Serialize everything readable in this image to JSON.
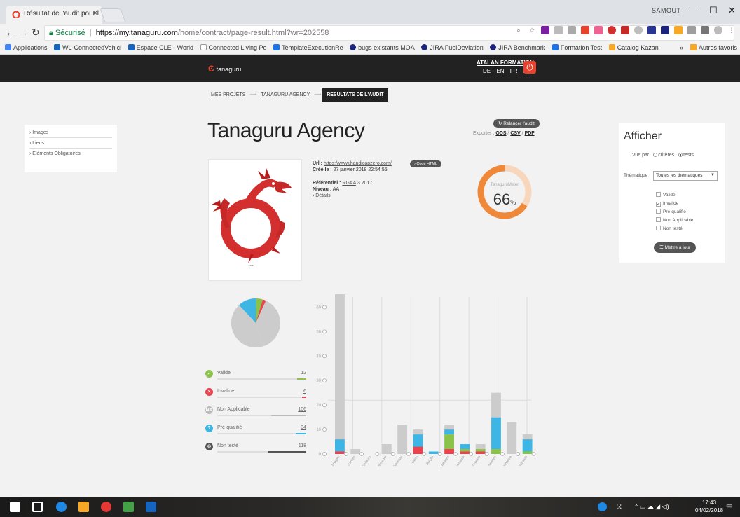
{
  "browser": {
    "tab_title": "Résultat de l'audit pour l",
    "tab_close": "×",
    "user_label": "SAMOUT",
    "minimize": "—",
    "maximize": "☐",
    "close": "✕",
    "secure_label": "Sécurisé",
    "url_host": "https://my.tanaguru.com",
    "url_path": "/home/contract/page-result.html?wr=202558"
  },
  "bookmarks": [
    {
      "label": "Applications",
      "color": "#4285f4"
    },
    {
      "label": "WL-ConnectedVehicl",
      "color": "#1565c0"
    },
    {
      "label": "Espace CLE - World",
      "color": "#1565c0"
    },
    {
      "label": "Connected Living Po",
      "color": "#9e9e9e"
    },
    {
      "label": "TemplateExecutionRe",
      "color": "#1a73e8"
    },
    {
      "label": "bugs existants MOA",
      "color": "#1a237e"
    },
    {
      "label": "JIRA FuelDeviation",
      "color": "#1a237e"
    },
    {
      "label": "JIRA Benchmark",
      "color": "#1a237e"
    },
    {
      "label": "Formation Test",
      "color": "#1a73e8"
    },
    {
      "label": "Catalog Kazan",
      "color": "#f9a825"
    }
  ],
  "bookmarks_more": "»",
  "bookmarks_other": "Autres favoris",
  "header": {
    "logo_text": "tanaguru",
    "account": "ATALAN FORMATION",
    "langs": [
      "DE",
      "EN",
      "FR",
      "ES"
    ]
  },
  "breadcrumb": {
    "items": [
      "MES PROJETS",
      "TANAGURU AGENCY"
    ],
    "separator": "⟶",
    "active": "RESULTATS DE L'AUDIT"
  },
  "sidebar": {
    "items": [
      "Images",
      "Liens",
      "Eléments Obligatoires"
    ]
  },
  "audit": {
    "title": "Tanaguru Agency",
    "relaunch_label": "Relancer l'audit",
    "export_label": "Exporter :",
    "export_formats": [
      "ODS",
      "CSV",
      "PDF"
    ],
    "url_label": "Url :",
    "url_value": "https://www.handicapzero.com/",
    "code_button": "Code HTML",
    "created_label": "Créé le :",
    "created_value": "27 janvier 2018 22:54:55",
    "ref_label": "Référentiel :",
    "ref_abbr": "RGAA",
    "ref_version": "3 2017",
    "level_label": "Niveau :",
    "level_value": "AA",
    "details_label": "Détails"
  },
  "gauge": {
    "label": "TanaguruMeter",
    "value": "66",
    "unit": "%",
    "fraction": 0.66,
    "color": "#f0883a",
    "track_color": "#f8d6bb"
  },
  "panel": {
    "title": "Afficher",
    "vue_label": "Vue par",
    "vue_options": [
      "critères",
      "tests"
    ],
    "vue_selected": "tests",
    "theme_label": "Thématique",
    "theme_value": "Toutes les thématiques",
    "checkboxes": [
      {
        "label": "Valide",
        "checked": false
      },
      {
        "label": "Invalide",
        "checked": true
      },
      {
        "label": "Pré-qualifié",
        "checked": false
      },
      {
        "label": "Non Applicable",
        "checked": false
      },
      {
        "label": "Non testé",
        "checked": false
      }
    ],
    "update_label": "Mettre à jour"
  },
  "legend": [
    {
      "label": "Valide",
      "count": "12",
      "color": "#8bc34a",
      "icon": "✓",
      "fill": 0.1
    },
    {
      "label": "Invalide",
      "count": "6",
      "color": "#e8434f",
      "icon": "✕",
      "fill": 0.05
    },
    {
      "label": "Non Applicable",
      "count": "106",
      "color": "#bbbbbb",
      "icon": "NA",
      "fill": 0.39
    },
    {
      "label": "Pré-qualifié",
      "count": "34",
      "color": "#3db6e6",
      "icon": "?",
      "fill": 0.12
    },
    {
      "label": "Non testé",
      "count": "118",
      "color": "#555555",
      "icon": "⊘",
      "fill": 0.43
    }
  ],
  "chart_data": [
    {
      "type": "pie",
      "labels": [
        "Valide",
        "Invalide",
        "Non Applicable",
        "Pré-qualifié",
        "Non testé"
      ],
      "values": [
        12,
        6,
        106,
        34,
        118
      ],
      "colors": [
        "#8bc34a",
        "#e8434f",
        "#cccccc",
        "#3db6e6",
        "#cccccc"
      ]
    },
    {
      "type": "bar",
      "stacked": true,
      "categories": [
        "Images",
        "Cadres",
        "Couleurs",
        "Multimédia",
        "Tableaux",
        "Liens",
        "Scripts",
        "Eléments Obligatoires",
        "Structuration de l'information",
        "Présentation de l'information",
        "Formulaires",
        "Navigation",
        "Consultation"
      ],
      "series": [
        {
          "name": "Invalide",
          "color": "#e8434f",
          "values": [
            1,
            0,
            0,
            0,
            0,
            3,
            0,
            2,
            1,
            1,
            0,
            0,
            0
          ]
        },
        {
          "name": "Valide",
          "color": "#8bc34a",
          "values": [
            0,
            0,
            0,
            0,
            0,
            0,
            0,
            6,
            1,
            1,
            2,
            0,
            1
          ]
        },
        {
          "name": "Pré-qualifié",
          "color": "#3db6e6",
          "values": [
            5,
            0,
            0,
            0,
            0,
            5,
            1,
            2,
            2,
            0,
            13,
            0,
            5
          ]
        },
        {
          "name": "Non Applicable",
          "color": "#cccccc",
          "values": [
            60,
            2,
            0,
            4,
            12,
            2,
            0,
            2,
            0,
            2,
            10,
            13,
            2
          ]
        }
      ],
      "ylim": [
        0,
        63
      ],
      "yticks": [
        0,
        10,
        20,
        30,
        40,
        50,
        60
      ]
    }
  ],
  "taskbar": {
    "time": "17:43",
    "date": "04/02/2018"
  }
}
